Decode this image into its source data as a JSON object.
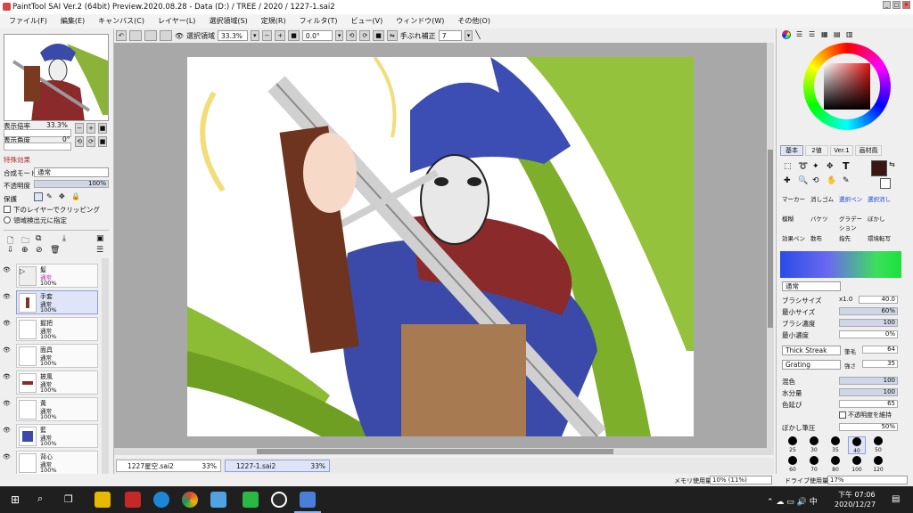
{
  "window": {
    "title": "PaintTool SAI Ver.2 (64bit) Preview.2020.08.28 - Data (D:) / TREE / 2020 / 1227-1.sai2"
  },
  "menu": [
    "ファイル(F)",
    "編集(E)",
    "キャンバス(C)",
    "レイヤー(L)",
    "選択領域(S)",
    "定規(R)",
    "フィルタ(T)",
    "ビュー(V)",
    "ウィンドウ(W)",
    "その他(O)"
  ],
  "toolbar": {
    "sel_label": "選択領域",
    "zoom": "33.3%",
    "angle": "0.0°",
    "stab_label": "手ぶれ補正",
    "stab": "7"
  },
  "nav": {
    "zoom_label": "表示倍率",
    "zoom": "33.3%",
    "angle_label": "表示角度",
    "angle": "0°"
  },
  "effects": {
    "header": "特殊効果",
    "blend_label": "合成モード",
    "blend": "通常",
    "opacity_label": "不透明度",
    "opacity": "100%",
    "protect_label": "保護",
    "clip_label": "下のレイヤーでクリッピング",
    "sel_src_label": "領域検出元に指定"
  },
  "layers": [
    {
      "name": "髪",
      "mode": "通常",
      "opacity": "100%"
    },
    {
      "name": "手套",
      "mode": "通常",
      "opacity": "100%"
    },
    {
      "name": "握把",
      "mode": "通常",
      "opacity": "100%"
    },
    {
      "name": "面具",
      "mode": "通常",
      "opacity": "100%"
    },
    {
      "name": "披風",
      "mode": "通常",
      "opacity": "100%"
    },
    {
      "name": "黃",
      "mode": "通常",
      "opacity": "100%"
    },
    {
      "name": "藍",
      "mode": "通常",
      "opacity": "100%"
    },
    {
      "name": "背心",
      "mode": "通常",
      "opacity": "100%"
    }
  ],
  "tabs": [
    {
      "name": "1227星空.sai2",
      "zoom": "33%"
    },
    {
      "name": "1227-1.sai2",
      "zoom": "33%"
    }
  ],
  "color_tabs": [
    "基本",
    "2値",
    "Ver.1",
    "画材風"
  ],
  "brush_tools": [
    [
      "マーカー",
      "消しゴム",
      "選択ペン",
      "選択消し"
    ],
    [
      "模糊",
      "バケツ",
      "グラデーション",
      "ぼかし"
    ],
    [
      "効果ペン",
      "散布",
      "指先",
      "環境転写"
    ]
  ],
  "brush": {
    "mode": "通常",
    "size_label": "ブラシサイズ",
    "size_mult": "x1.0",
    "size": "40.0",
    "min_size_label": "最小サイズ",
    "min_size": "60%",
    "density_label": "ブラシ濃度",
    "density": "100",
    "min_density_label": "最小濃度",
    "min_density": "0%",
    "tex1": "Thick Streak",
    "tex1_label": "筆毛",
    "tex1_val": "64",
    "tex2": "Grating",
    "tex2_label": "強さ",
    "tex2_val": "35",
    "mix_label": "混色",
    "mix": "100",
    "water_label": "水分量",
    "water": "100",
    "persist_label": "色延び",
    "persist": "65",
    "keep_op_label": "不透明度を維持",
    "blur_label": "ぼかし筆圧",
    "blur": "50%"
  },
  "brush_sizes": [
    "25",
    "30",
    "35",
    "40",
    "50",
    "60",
    "70",
    "80",
    "100",
    "120"
  ],
  "status": {
    "mem_label": "メモリ使用量",
    "mem": "10% (11%)",
    "drive_label": "ドライブ使用量",
    "drive": "17%"
  },
  "clock": {
    "time": "下午 07:06",
    "date": "2020/12/27"
  },
  "colors": {
    "primary": "#3a1712",
    "accent": "#1a73e8"
  }
}
